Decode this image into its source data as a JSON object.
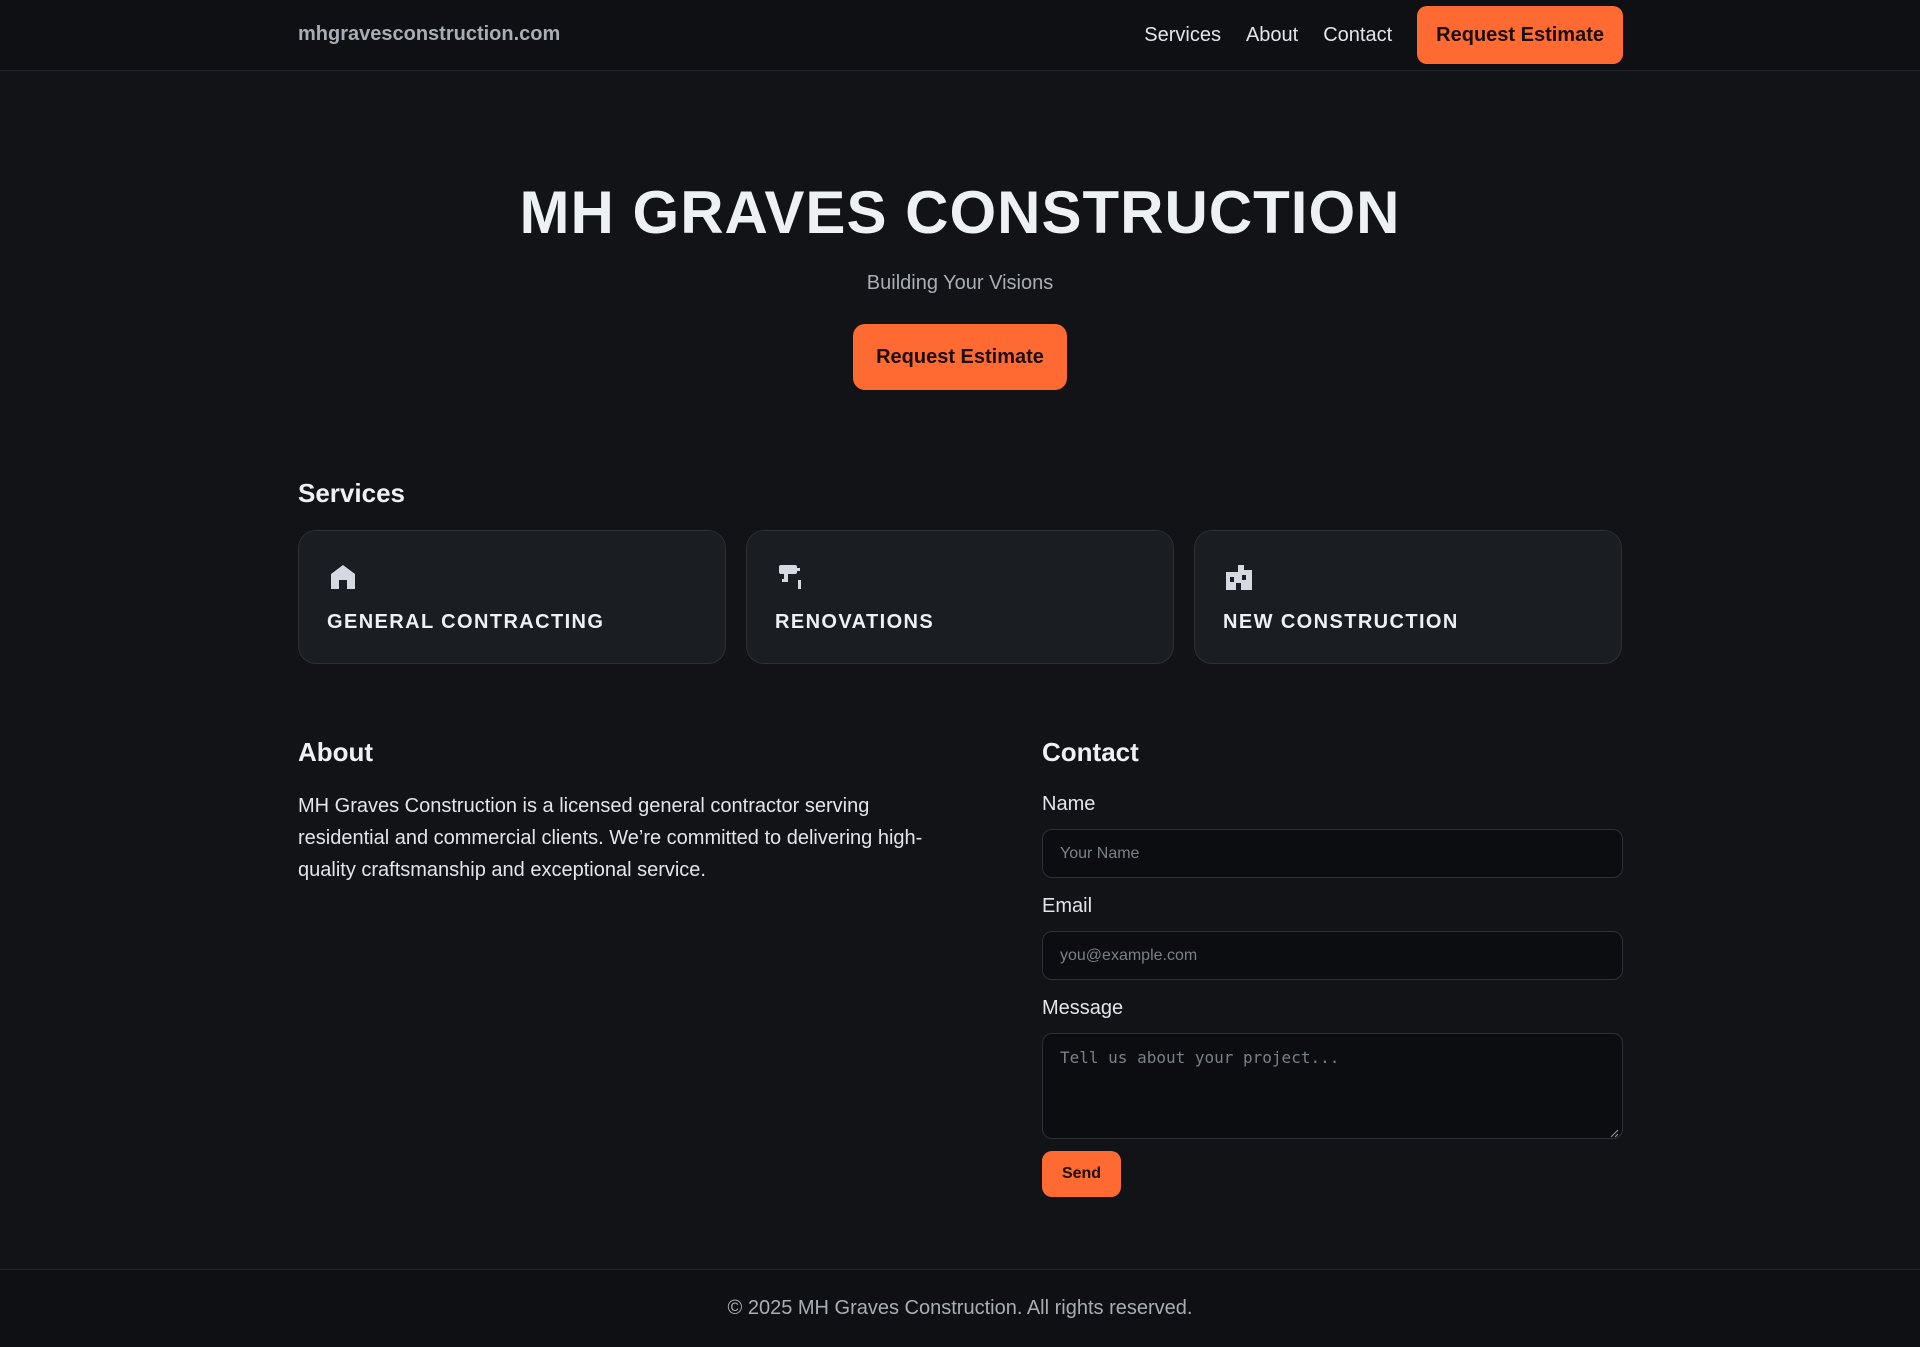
{
  "header": {
    "site_name": "mhgravesconstruction.com",
    "nav": [
      "Services",
      "About",
      "Contact"
    ],
    "cta_label": "Request Estimate"
  },
  "hero": {
    "title": "MH GRAVES CONSTRUCTION",
    "subtitle": "Building Your Visions",
    "cta_label": "Request Estimate"
  },
  "services": {
    "title": "Services",
    "items": [
      {
        "label": "GENERAL CONTRACTING",
        "icon": "house-icon"
      },
      {
        "label": "RENOVATIONS",
        "icon": "paint-roller-icon"
      },
      {
        "label": "NEW CONSTRUCTION",
        "icon": "building-icon"
      }
    ]
  },
  "about": {
    "title": "About",
    "text": "MH Graves Construction is a licensed general contractor serving residential and commercial clients. We’re committed to delivering high-quality craftsmanship and exceptional service."
  },
  "contact": {
    "title": "Contact",
    "name_label": "Name",
    "name_placeholder": "Your Name",
    "email_label": "Email",
    "email_placeholder": "you@example.com",
    "message_label": "Message",
    "message_placeholder": "Tell us about your project...",
    "send_label": "Send"
  },
  "footer": {
    "text": "© 2025 MH Graves Construction. All rights reserved."
  },
  "colors": {
    "accent": "#ff6a33",
    "background": "#111316",
    "card": "#1a1d22"
  }
}
